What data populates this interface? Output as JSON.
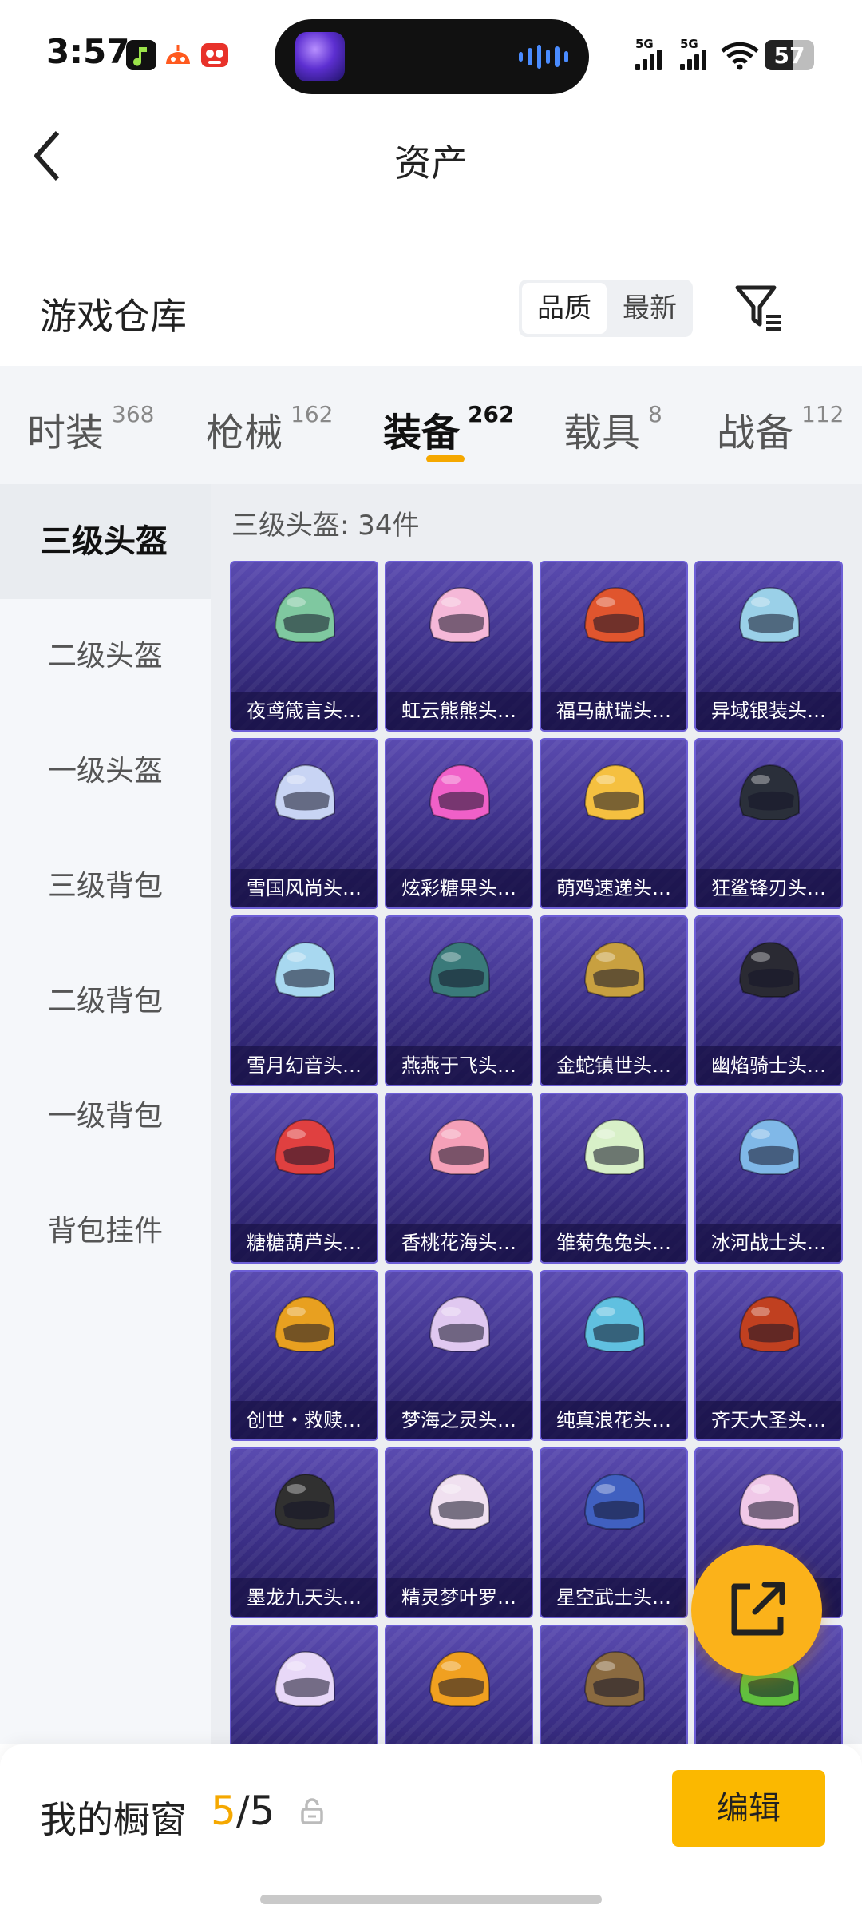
{
  "status_bar": {
    "time": "3:57",
    "battery": "57",
    "battery_level": 0.57,
    "signal1": "5G",
    "signal2": "5G"
  },
  "header": {
    "title": "资产"
  },
  "section": {
    "title": "游戏仓库",
    "sort_quality": "品质",
    "sort_latest": "最新"
  },
  "tabs": [
    {
      "label": "时装",
      "count": "368"
    },
    {
      "label": "枪械",
      "count": "162"
    },
    {
      "label": "装备",
      "count": "262",
      "active": true
    },
    {
      "label": "载具",
      "count": "8"
    },
    {
      "label": "战备",
      "count": "112"
    }
  ],
  "sidebar": {
    "items": [
      {
        "label": "三级头盔",
        "active": true
      },
      {
        "label": "二级头盔"
      },
      {
        "label": "一级头盔"
      },
      {
        "label": "三级背包"
      },
      {
        "label": "二级背包"
      },
      {
        "label": "一级背包"
      },
      {
        "label": "背包挂件"
      }
    ]
  },
  "content": {
    "header": "三级头盔: 34件",
    "items": [
      {
        "label": "夜鸢箴言头…",
        "color": "#7fc8a0"
      },
      {
        "label": "虹云熊熊头…",
        "color": "#f5b8d8"
      },
      {
        "label": "福马献瑞头…",
        "color": "#e0552e"
      },
      {
        "label": "异域银装头…",
        "color": "#9ad0e8"
      },
      {
        "label": "雪国风尚头…",
        "color": "#c8d4f4"
      },
      {
        "label": "炫彩糖果头…",
        "color": "#f060c8"
      },
      {
        "label": "萌鸡速递头…",
        "color": "#f5c040"
      },
      {
        "label": "狂鲨锋刃头…",
        "color": "#2a2f3a"
      },
      {
        "label": "雪月幻音头…",
        "color": "#a8d8f0"
      },
      {
        "label": "燕燕于飞头…",
        "color": "#3a7a7a"
      },
      {
        "label": "金蛇镇世头…",
        "color": "#c8a040"
      },
      {
        "label": "幽焰骑士头…",
        "color": "#2a2a33"
      },
      {
        "label": "糖糖葫芦头…",
        "color": "#e04040"
      },
      {
        "label": "香桃花海头…",
        "color": "#f5a0b8"
      },
      {
        "label": "雏菊兔兔头…",
        "color": "#d8f0c8"
      },
      {
        "label": "冰河战士头…",
        "color": "#80b8e8"
      },
      {
        "label": "创世・救赎…",
        "color": "#e8a020"
      },
      {
        "label": "梦海之灵头…",
        "color": "#e0c8f0"
      },
      {
        "label": "纯真浪花头…",
        "color": "#60c0e0"
      },
      {
        "label": "齐天大圣头…",
        "color": "#c04020"
      },
      {
        "label": "墨龙九天头…",
        "color": "#303030"
      },
      {
        "label": "精灵梦叶罗…",
        "color": "#f0e0f0"
      },
      {
        "label": "星空武士头…",
        "color": "#4060c0"
      },
      {
        "label": "",
        "color": "#f0c8e8"
      },
      {
        "label": "",
        "color": "#e8d8f8"
      },
      {
        "label": "",
        "color": "#f0a020"
      },
      {
        "label": "",
        "color": "#8a6a40"
      },
      {
        "label": "",
        "color": "#60c040"
      }
    ]
  },
  "bottom_bar": {
    "label": "我的橱窗",
    "count_current": "5",
    "count_sep": "/",
    "count_total": "5",
    "edit_label": "编辑"
  },
  "colors": {
    "accent": "#f5a800",
    "card_bg": "#3b2f86"
  }
}
